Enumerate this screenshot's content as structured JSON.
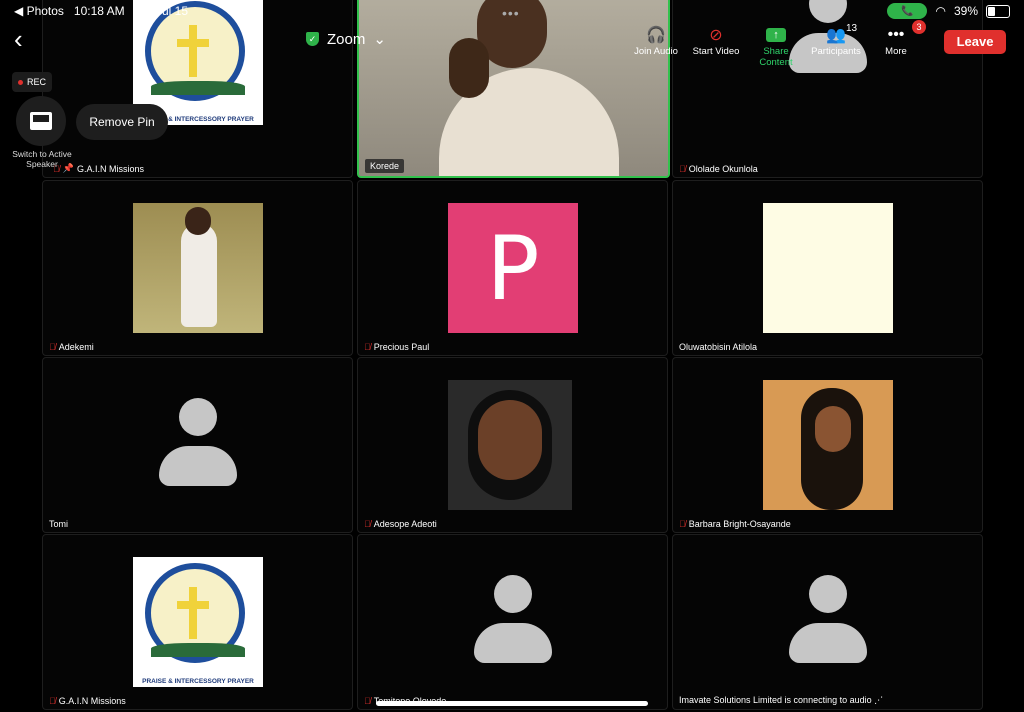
{
  "status": {
    "back_app": "◀ Photos",
    "time": "10:18 AM",
    "date": "Sat Jul 15",
    "battery": "39%",
    "battery_level": 0.39
  },
  "toolbar": {
    "title": "Zoom",
    "items": [
      {
        "label": "Join Audio",
        "icon": "headphones-icon"
      },
      {
        "label": "Start Video",
        "icon": "video-off-icon"
      },
      {
        "label": "Share Content",
        "icon": "share-icon"
      },
      {
        "label": "Participants",
        "icon": "participants-icon",
        "count": "13"
      },
      {
        "label": "More",
        "icon": "more-icon",
        "badge": "3"
      }
    ],
    "leave": "Leave"
  },
  "overlay": {
    "rec": "REC",
    "switch_label": "Switch to Active Speaker",
    "remove_pin": "Remove Pin"
  },
  "tiles": [
    {
      "name": "G.A.I.N Missions",
      "muted": true,
      "pinned": true,
      "kind": "logo"
    },
    {
      "name": "Korede",
      "muted": false,
      "kind": "video",
      "active": true
    },
    {
      "name": "Ololade Okunlola",
      "muted": true,
      "kind": "avatar"
    },
    {
      "name": "Adekemi",
      "muted": true,
      "kind": "photo1"
    },
    {
      "name": "Precious Paul",
      "muted": true,
      "kind": "letter",
      "letter": "P"
    },
    {
      "name": "Oluwatobisin Atilola",
      "muted": false,
      "kind": "blank"
    },
    {
      "name": "Tomi",
      "muted": false,
      "kind": "avatar"
    },
    {
      "name": "Adesope Adeoti",
      "muted": true,
      "kind": "photo2"
    },
    {
      "name": "Barbara Bright-Osayande",
      "muted": true,
      "kind": "photo3"
    },
    {
      "name": "G.A.I.N Missions",
      "muted": true,
      "kind": "logo"
    },
    {
      "name": "Temitope Oloyede",
      "muted": true,
      "kind": "avatar"
    },
    {
      "name": "Imavate Solutions Limited is connecting to audio ⋰",
      "muted": false,
      "kind": "avatar"
    }
  ],
  "logo": {
    "caption1": "GLOBAL APOSTOLIC MISSION",
    "caption2": "PRAISE & INTERCESSORY PRAYER"
  },
  "colors": {
    "accent": "#2fb34a",
    "leave": "#e0302d",
    "letter_bg": "#e23e74"
  }
}
